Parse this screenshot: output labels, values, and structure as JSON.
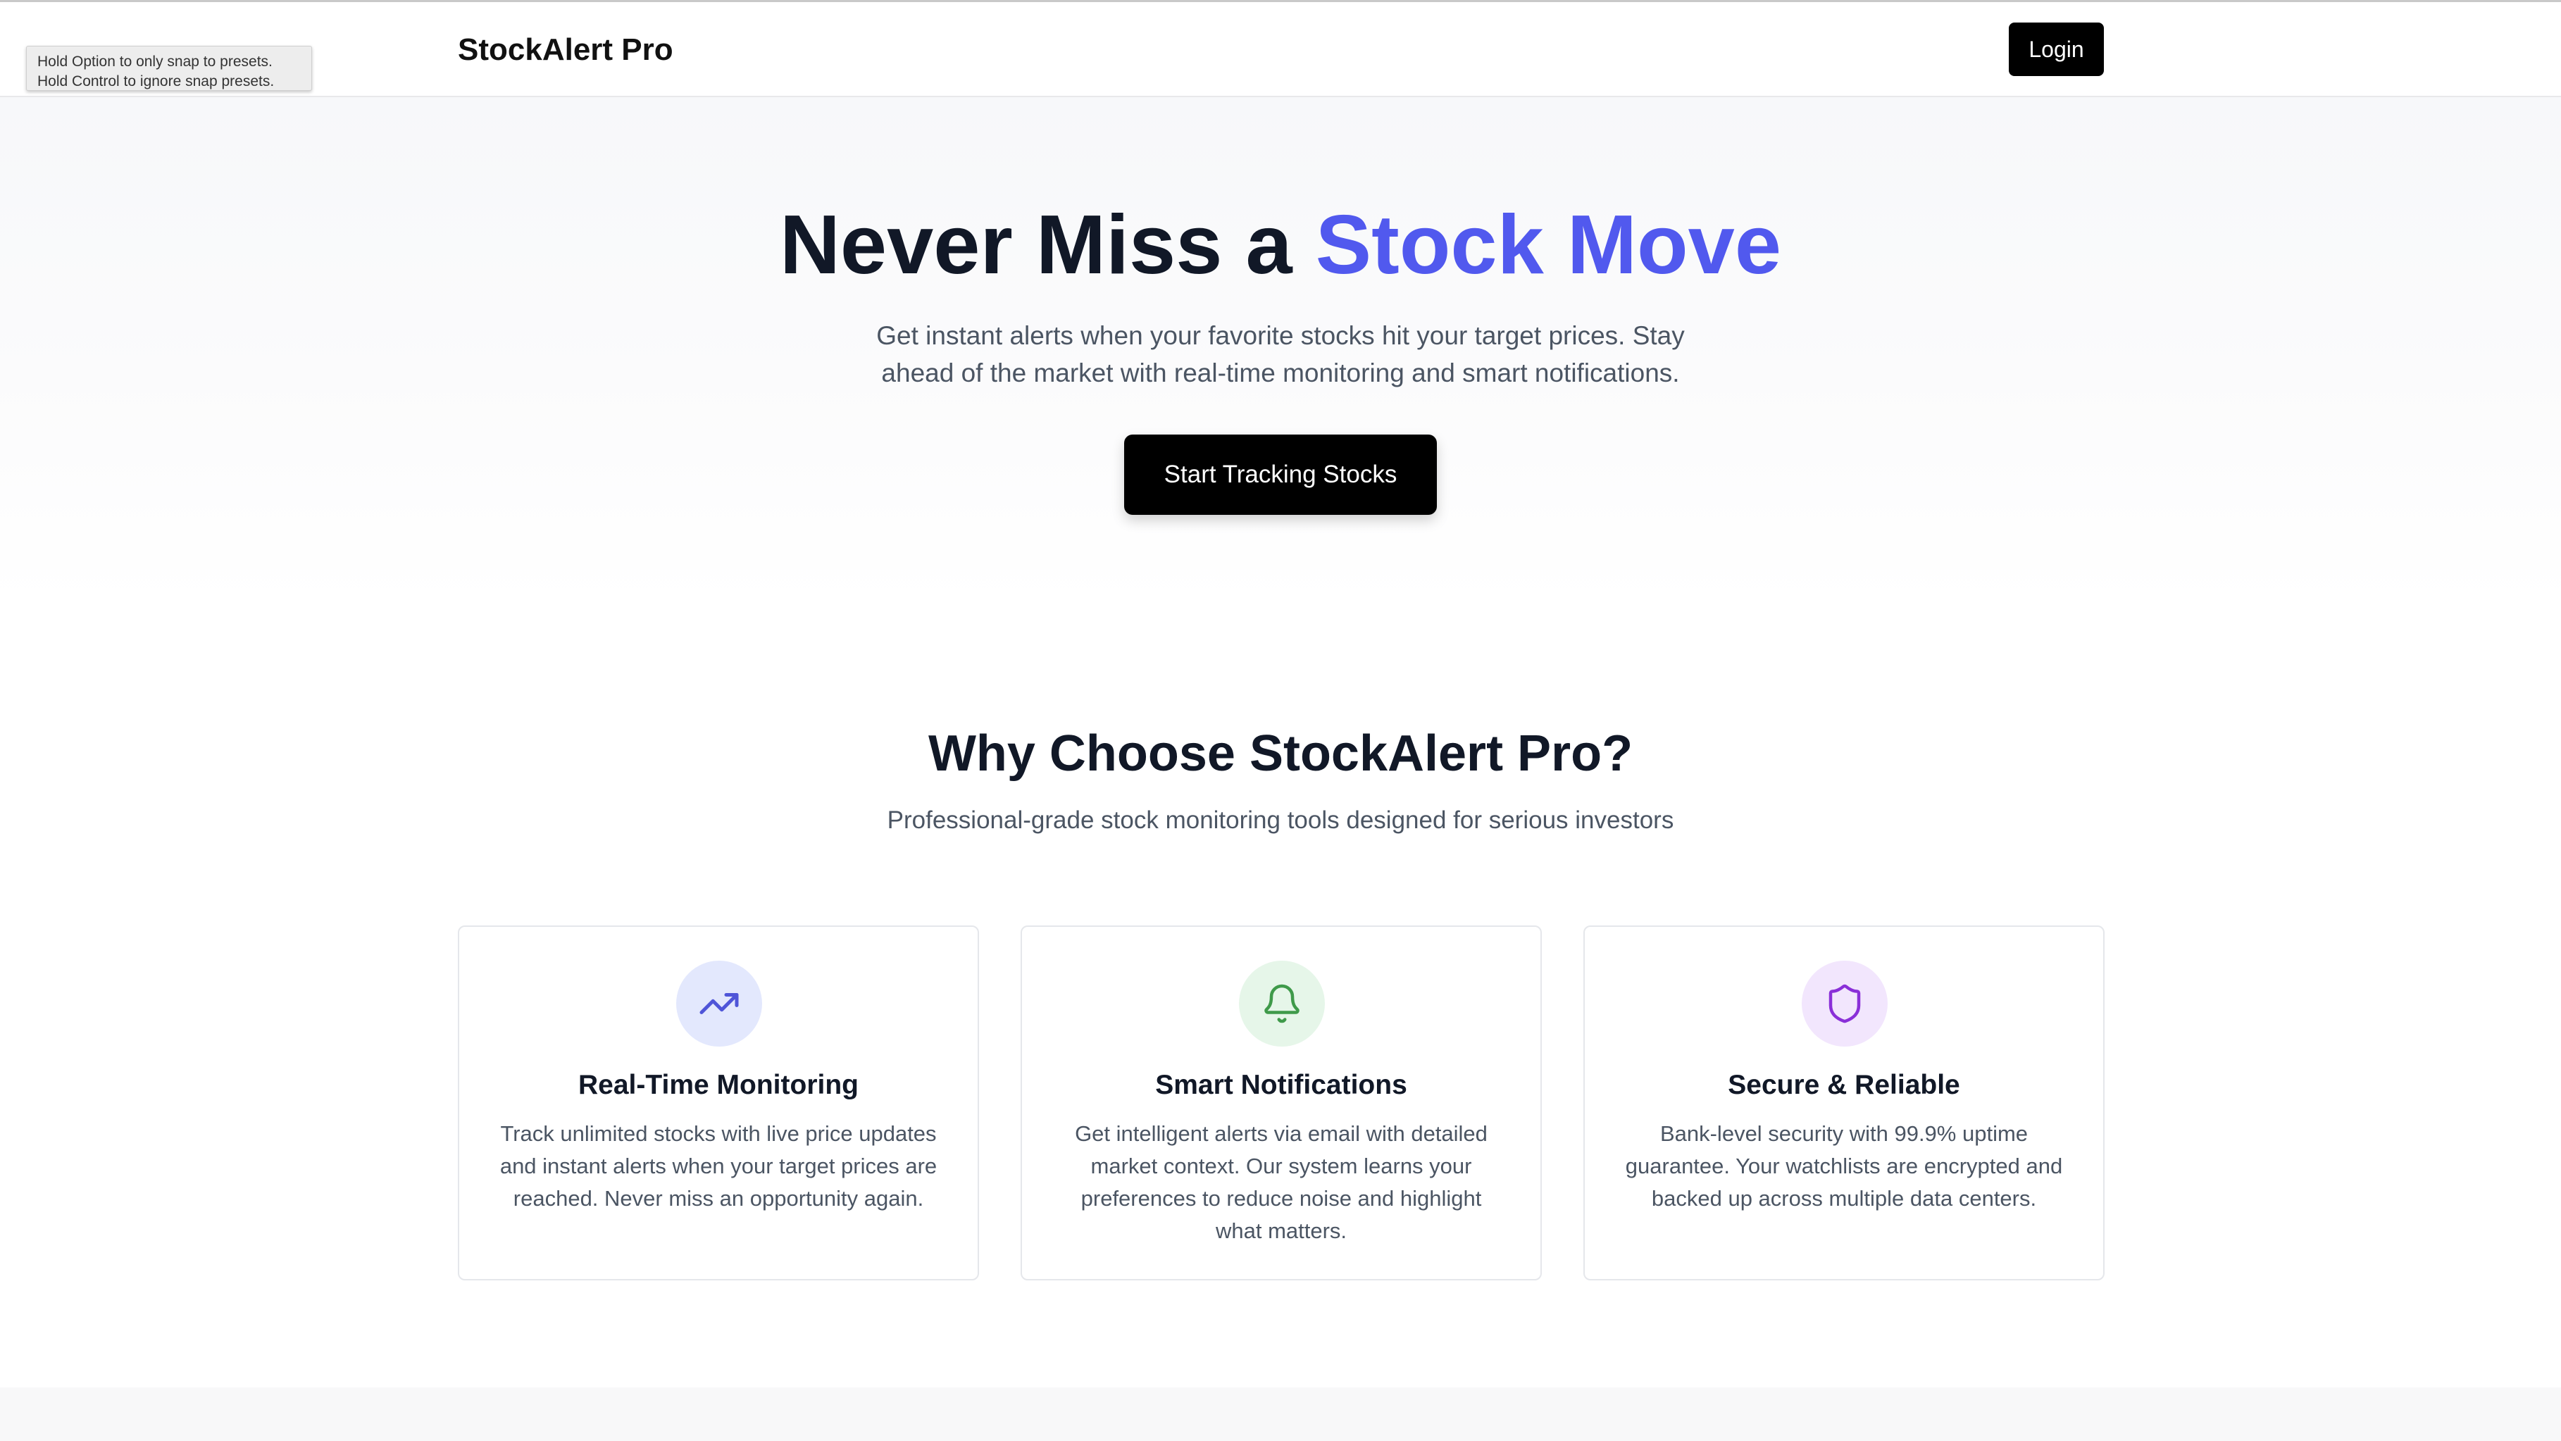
{
  "tooltip": {
    "line1": "Hold Option to only snap to presets.",
    "line2": "Hold Control to ignore snap presets."
  },
  "header": {
    "brand": "StockAlert Pro",
    "login_label": "Login"
  },
  "hero": {
    "title_main": "Never Miss a",
    "title_accent": "Stock Move",
    "subtitle_line1": "Get instant alerts when your favorite stocks hit your target prices. Stay",
    "subtitle_line2": "ahead of the market with real-time monitoring and smart notifications.",
    "cta_label": "Start Tracking Stocks"
  },
  "features": {
    "title": "Why Choose StockAlert Pro?",
    "subtitle": "Professional-grade stock monitoring tools designed for serious investors",
    "cards": [
      {
        "icon": "trending-up-icon",
        "title": "Real-Time Monitoring",
        "body": "Track unlimited stocks with live price updates and instant alerts when your target prices are reached. Never miss an opportunity again."
      },
      {
        "icon": "bell-icon",
        "title": "Smart Notifications",
        "body": "Get intelligent alerts via email with detailed market context. Our system learns your preferences to reduce noise and highlight what matters."
      },
      {
        "icon": "shield-icon",
        "title": "Secure & Reliable",
        "body": "Bank-level security with 99.9% uptime guarantee. Your watchlists are encrypted and backed up across multiple data centers."
      }
    ]
  },
  "colors": {
    "accent": "#5159ee",
    "text_primary": "#111827",
    "text_secondary": "#4b5563",
    "button_bg": "#000000",
    "icon_blue_bg": "#e3e8fd",
    "icon_blue": "#4f55d8",
    "icon_green_bg": "#e6f6e9",
    "icon_green": "#3f9a4a",
    "icon_purple_bg": "#f2e6fd",
    "icon_purple": "#8a2fd8"
  }
}
